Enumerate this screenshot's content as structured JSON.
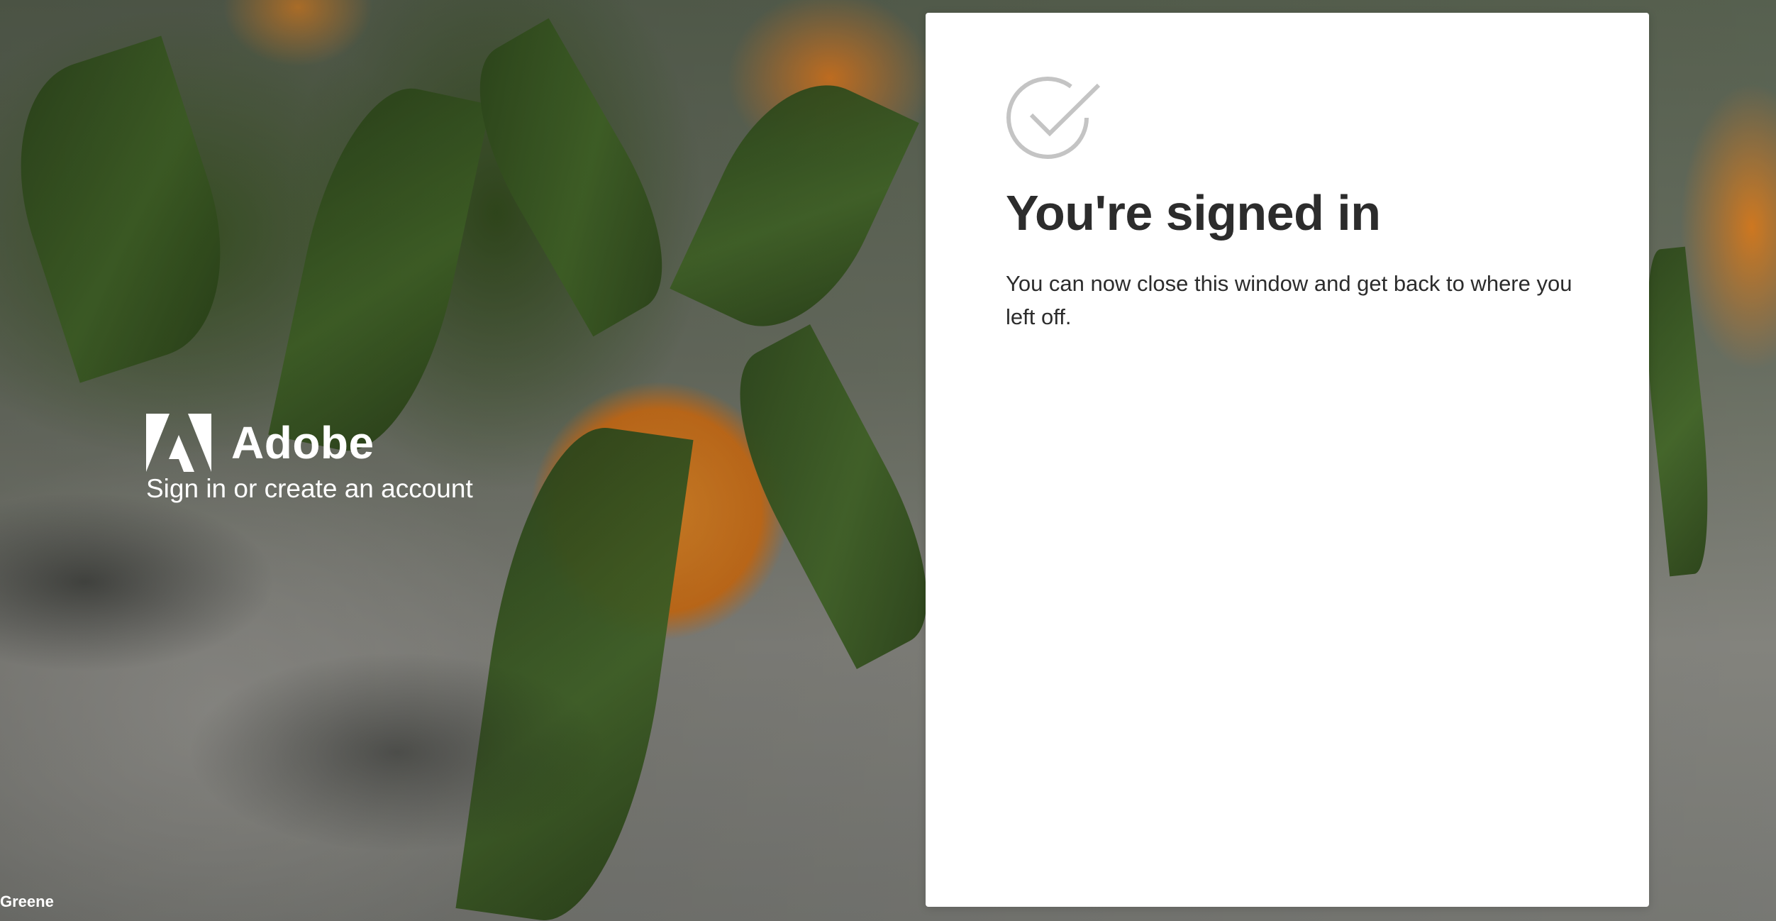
{
  "background": {
    "photo_credit": "Greene"
  },
  "brand": {
    "logo_icon": "adobe-logo-icon",
    "name": "Adobe",
    "tagline": "Sign in or create an account"
  },
  "card": {
    "status_icon": "check-circle-icon",
    "title": "You're signed in",
    "message": "You can now close this window and get back to where you left off."
  },
  "colors": {
    "card_background": "#ffffff",
    "text_primary": "#2c2c2c",
    "icon_gray": "#c4c4c4",
    "brand_text": "#ffffff"
  }
}
